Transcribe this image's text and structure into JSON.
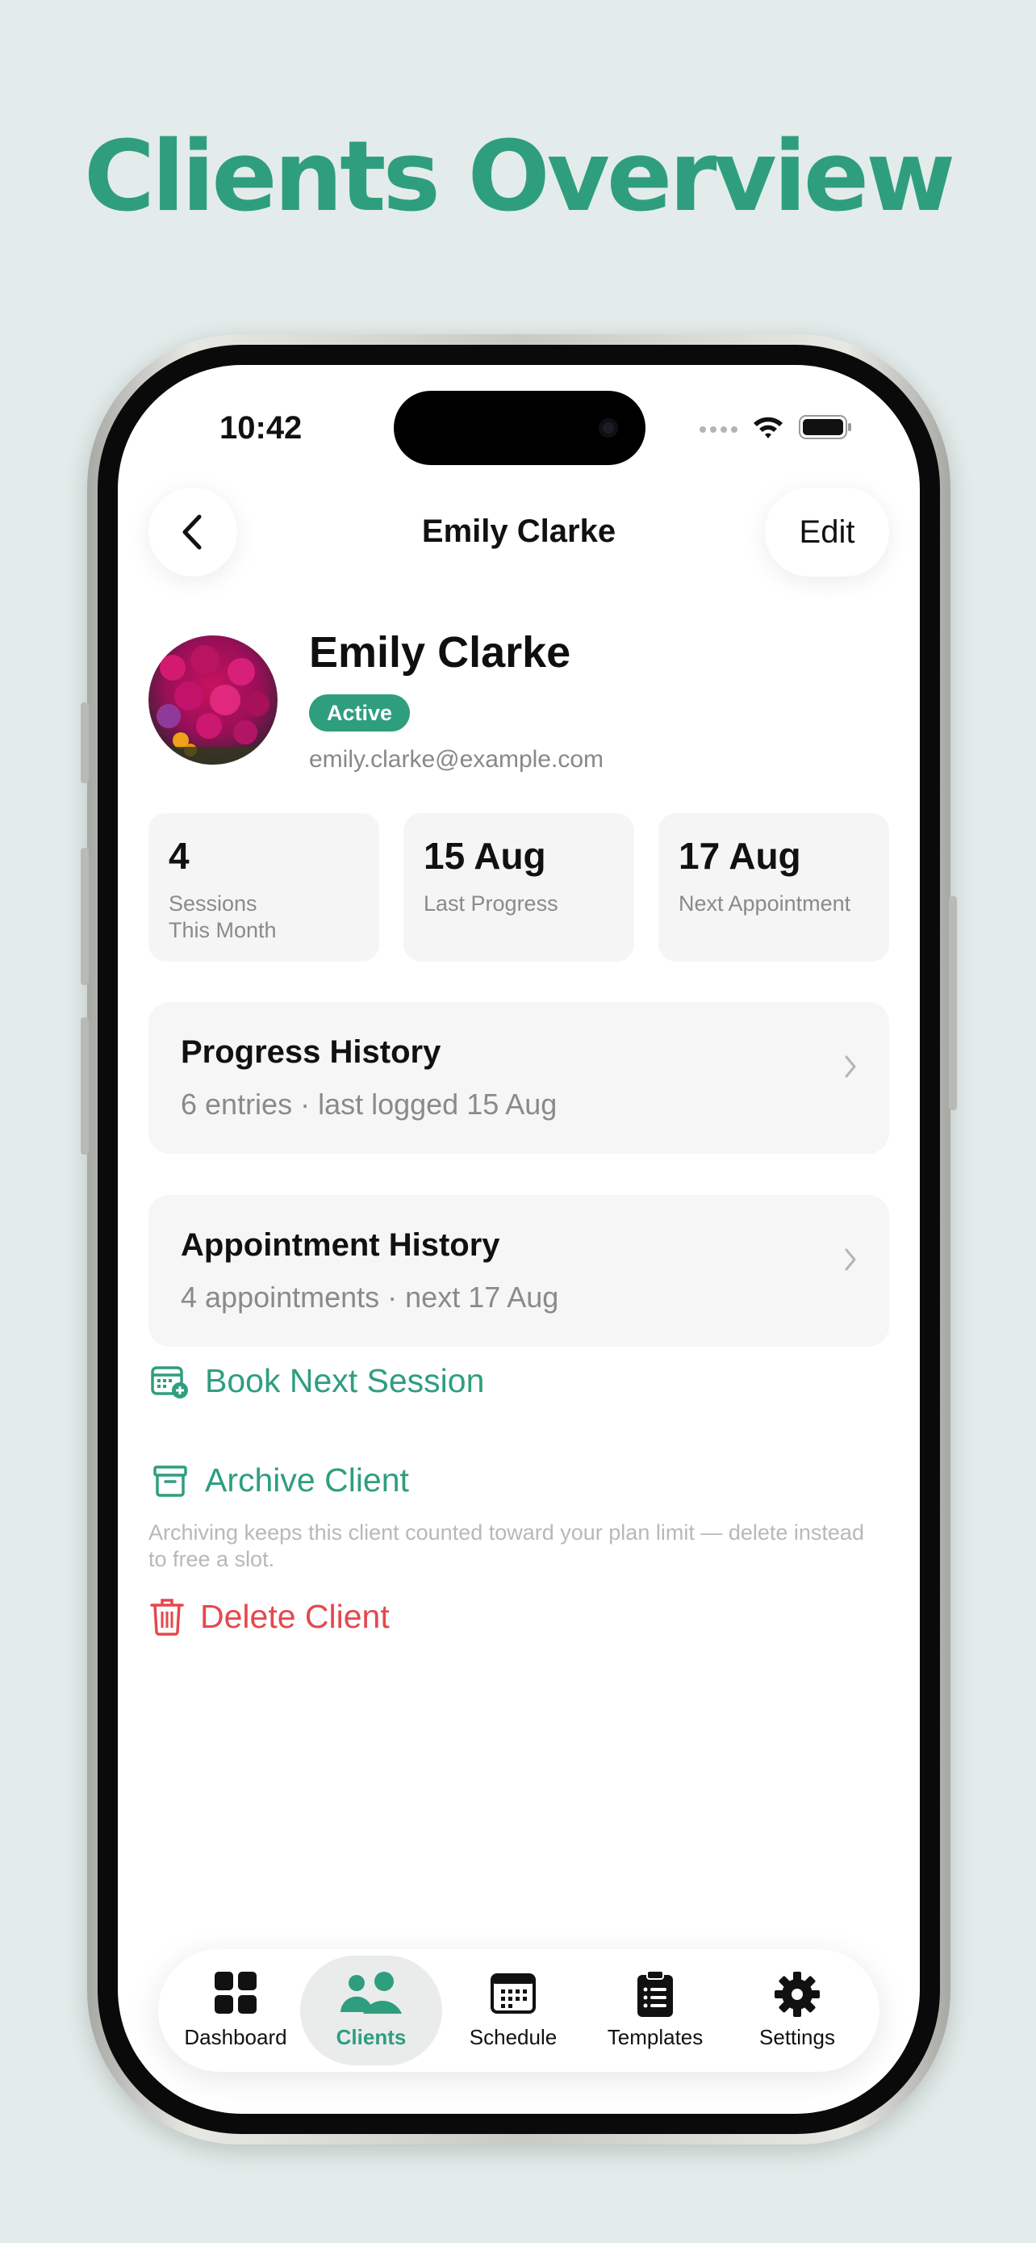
{
  "headline": "Clients Overview",
  "status_bar": {
    "time": "10:42"
  },
  "nav": {
    "title": "Emily Clarke",
    "edit_label": "Edit"
  },
  "profile": {
    "name": "Emily Clarke",
    "status_badge": "Active",
    "email": "emily.clarke@example.com"
  },
  "stats": [
    {
      "value": "4",
      "label": "Sessions This Month"
    },
    {
      "value": "15 Aug",
      "label": "Last Progress"
    },
    {
      "value": "17 Aug",
      "label": "Next Appointment"
    }
  ],
  "cards": [
    {
      "title": "Progress History",
      "subtitle": "6 entries · last logged 15 Aug"
    },
    {
      "title": "Appointment History",
      "subtitle": "4 appointments · next 17 Aug"
    }
  ],
  "actions": {
    "book": "Book Next Session",
    "archive": "Archive Client",
    "archive_note": "Archiving keeps this client counted toward your plan limit — delete instead to free a slot.",
    "delete": "Delete Client"
  },
  "tabbar": {
    "active": "Clients",
    "items": [
      {
        "label": "Dashboard",
        "icon": "grid-icon"
      },
      {
        "label": "Clients",
        "icon": "people-icon"
      },
      {
        "label": "Schedule",
        "icon": "calendar-icon"
      },
      {
        "label": "Templates",
        "icon": "clipboard-icon"
      },
      {
        "label": "Settings",
        "icon": "gear-icon"
      }
    ]
  },
  "colors": {
    "accent": "#2f9e7e",
    "danger": "#e5484d",
    "background": "#e3ecea",
    "card": "#f6f6f6"
  }
}
